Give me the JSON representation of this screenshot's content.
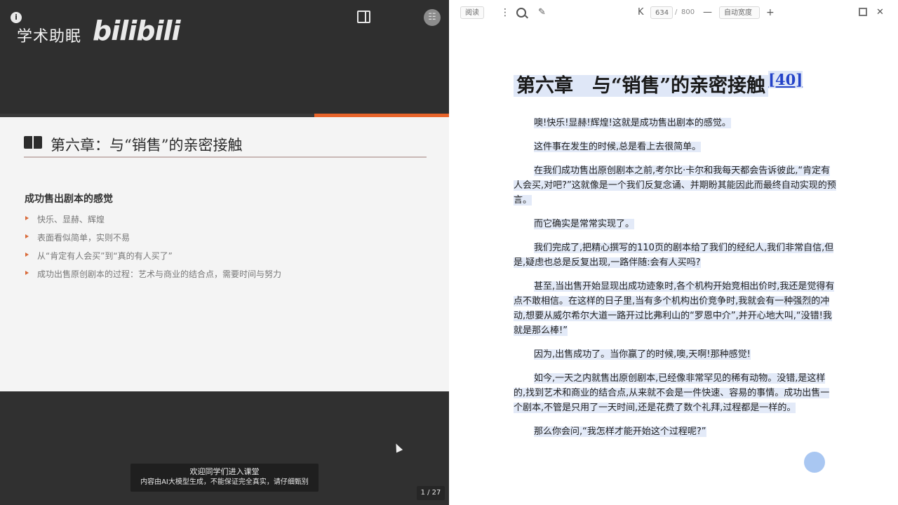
{
  "left_player": {
    "brand_text": "学术助眠",
    "brand_logo": "bilibili",
    "info_glyph": "i",
    "avatar_glyph": "☷",
    "progress_fraction": 0.7,
    "slide": {
      "title": "第六章：与“销售”的亲密接触",
      "subheading": "成功售出剧本的感觉",
      "bullets": [
        "快乐、显赫、辉煌",
        "表面看似简单，实则不易",
        "从“肯定有人会买”到“真的有人买了”",
        "成功出售原创剧本的过程：艺术与商业的结合点，需要时间与努力"
      ]
    },
    "subtitle": {
      "line1": "欢迎同学们进入课堂",
      "line2": "内容由AI大模型生成，不能保证完全真实，请仔细甄别"
    },
    "page_counter": "1 / 27"
  },
  "reader": {
    "toolbar": {
      "reading_label": "阅读",
      "more_glyph": "⋮",
      "annotate_glyph": "✎",
      "first_page_glyph": "K",
      "page_current": "634",
      "page_sep": "/",
      "page_total": "800",
      "zoom_out_glyph": "—",
      "zoom_mode": "自动宽度",
      "zoom_in_glyph": "+",
      "close_glyph": "✕"
    },
    "chapter_title_main": "第六章　与“销售”的亲密接触",
    "chapter_footnote": "[40]",
    "paragraphs": [
      "噢!快乐!显赫!辉煌!这就是成功售出剧本的感觉。",
      "这件事在发生的时候,总是看上去很简单。",
      "在我们成功售出原创剧本之前,考尔比·卡尔和我每天都会告诉彼此,“肯定有人会买,对吧?”这就像是一个我们反复念诵、并期盼其能因此而最终自动实现的预言。",
      "而它确实是常常实现了。",
      "我们完成了,把精心撰写的110页的剧本给了我们的经纪人,我们非常自信,但是,疑虑也总是反复出现,一路伴随:会有人买吗?",
      "甚至,当出售开始显现出成功迹象时,各个机构开始竞相出价时,我还是觉得有点不敢相信。在这样的日子里,当有多个机构出价竞争时,我就会有一种强烈的冲动,想要从威尔希尔大道一路开过比弗利山的“罗恩中介”,并开心地大叫,“没错!我就是那么棒!”",
      "因为,出售成功了。当你赢了的时候,噢,天啊!那种感觉!",
      "如今,一天之内就售出原创剧本,已经像非常罕见的稀有动物。没错,是这样的,找到艺术和商业的结合点,从来就不会是一件快速、容易的事情。成功出售一个剧本,不管是只用了一天时间,还是花费了数个礼拜,过程都是一样的。",
      "那么你会问,“我怎样才能开始这个过程呢?”"
    ]
  }
}
